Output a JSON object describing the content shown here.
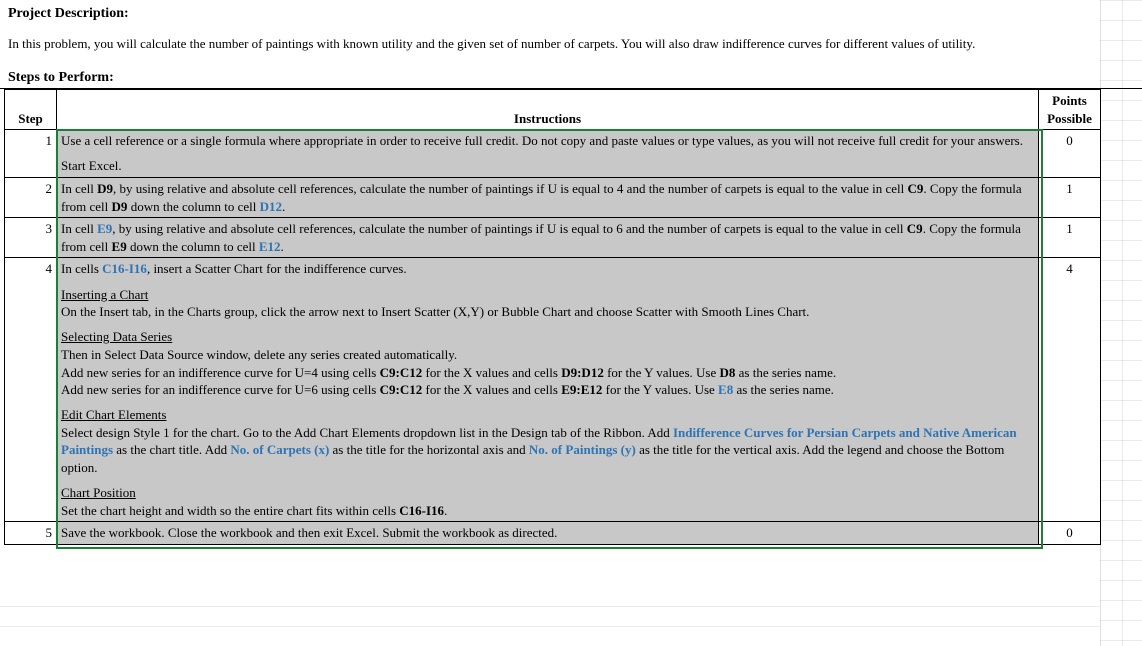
{
  "header": {
    "title": "Project Description:",
    "description": "In this problem, you will calculate the number of paintings with known utility and the given set of number of carpets. You will also draw indifference curves for different values of utility."
  },
  "steps_title": "Steps to Perform:",
  "columns": {
    "step": "Step",
    "instructions": "Instructions",
    "points": "Points Possible"
  },
  "rows": [
    {
      "step": "1",
      "points": "0",
      "lines": [
        [
          {
            "t": "Use a cell reference or a single formula where appropriate in order to receive full credit. Do not copy and paste values or type values, as you will not receive full credit for your answers."
          }
        ],
        [],
        [
          {
            "t": "Start Excel."
          }
        ]
      ]
    },
    {
      "step": "2",
      "points": "1",
      "lines": [
        [
          {
            "t": "In cell "
          },
          {
            "t": "D9",
            "cls": "b"
          },
          {
            "t": ", by using relative and absolute cell references, calculate the number of paintings if U is equal to 4 and the number of carpets is equal to the value in cell "
          },
          {
            "t": "C9",
            "cls": "b"
          },
          {
            "t": ". Copy the formula from cell "
          },
          {
            "t": "D9",
            "cls": "b"
          },
          {
            "t": " down the column to cell "
          },
          {
            "t": "D12",
            "cls": "blue"
          },
          {
            "t": "."
          }
        ]
      ]
    },
    {
      "step": "3",
      "points": "1",
      "lines": [
        [
          {
            "t": "In cell "
          },
          {
            "t": "E9",
            "cls": "blue"
          },
          {
            "t": ", by using relative and absolute cell references, calculate the number of paintings if U is equal to 6 and the number of carpets is equal to the value in cell "
          },
          {
            "t": "C9",
            "cls": "b"
          },
          {
            "t": ". Copy the formula from cell "
          },
          {
            "t": "E9",
            "cls": "b"
          },
          {
            "t": " down the column to cell "
          },
          {
            "t": "E12",
            "cls": "blue"
          },
          {
            "t": "."
          }
        ]
      ]
    },
    {
      "step": "4",
      "points": "4",
      "lines": [
        [
          {
            "t": "In cells "
          },
          {
            "t": "C16-I16",
            "cls": "blue"
          },
          {
            "t": ", insert a Scatter Chart for the indifference curves."
          }
        ],
        [],
        [
          {
            "t": "Inserting a Chart",
            "cls": "u"
          }
        ],
        [
          {
            "t": "On the Insert tab, in the Charts group, click the arrow next to Insert Scatter (X,Y) or Bubble Chart and choose Scatter with Smooth Lines Chart."
          }
        ],
        [],
        [
          {
            "t": "Selecting Data Series",
            "cls": "u"
          }
        ],
        [
          {
            "t": "Then in Select Data Source window, delete any series created automatically."
          }
        ],
        [
          {
            "t": "Add new series for an indifference curve for U=4 using cells "
          },
          {
            "t": "C9:C12",
            "cls": "b"
          },
          {
            "t": " for the X values and cells "
          },
          {
            "t": "D9:D12",
            "cls": "b"
          },
          {
            "t": " for the Y values. Use "
          },
          {
            "t": "D8",
            "cls": "b"
          },
          {
            "t": " as the series name."
          }
        ],
        [
          {
            "t": "Add new series for an indifference curve for U=6 using cells "
          },
          {
            "t": "C9:C12",
            "cls": "b"
          },
          {
            "t": " for the X values and cells "
          },
          {
            "t": "E9:E12",
            "cls": "b"
          },
          {
            "t": " for the Y values. Use "
          },
          {
            "t": "E8",
            "cls": "blue"
          },
          {
            "t": " as the series name."
          }
        ],
        [],
        [
          {
            "t": "Edit Chart Elements",
            "cls": "u"
          }
        ],
        [
          {
            "t": "Select design Style 1 for the chart. Go to the Add Chart Elements dropdown list in the Design tab of the Ribbon. Add "
          },
          {
            "t": "Indifference Curves for Persian Carpets and Native American Paintings",
            "cls": "blue"
          },
          {
            "t": " as the chart title. Add "
          },
          {
            "t": "No. of Carpets (x)",
            "cls": "blue"
          },
          {
            "t": " as the title for the horizontal axis and "
          },
          {
            "t": "No. of Paintings (y)",
            "cls": "blue"
          },
          {
            "t": " as the title for the vertical axis. Add the legend and choose the Bottom option."
          }
        ],
        [],
        [
          {
            "t": "Chart Position",
            "cls": "u"
          }
        ],
        [
          {
            "t": "Set the chart height and width so the entire chart fits within cells "
          },
          {
            "t": "C16-I16",
            "cls": "b"
          },
          {
            "t": "."
          }
        ]
      ]
    },
    {
      "step": "5",
      "points": "0",
      "lines": [
        [
          {
            "t": "Save the workbook. Close the workbook and then exit Excel. Submit the workbook as directed."
          }
        ]
      ]
    }
  ]
}
